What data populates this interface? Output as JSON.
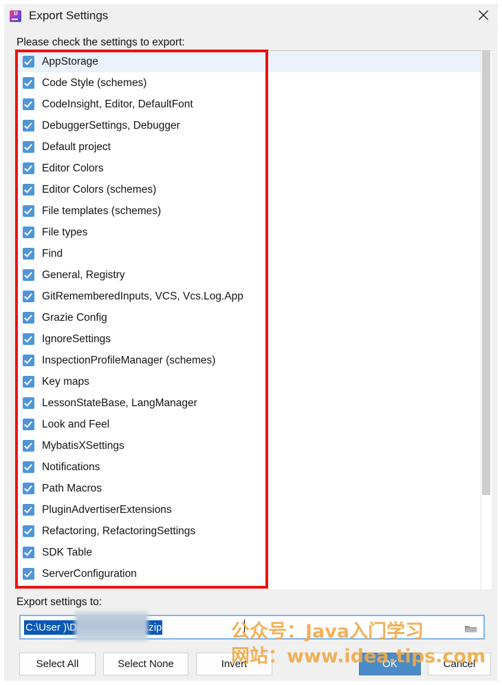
{
  "window": {
    "title": "Export Settings",
    "app_icon": "intellij-idea-icon",
    "close_icon": "close-icon"
  },
  "instruction": "Please check the settings to export:",
  "settings_list": {
    "items": [
      {
        "label": "AppStorage",
        "checked": true,
        "selected": true
      },
      {
        "label": "Code Style (schemes)",
        "checked": true,
        "selected": false
      },
      {
        "label": "CodeInsight, Editor, DefaultFont",
        "checked": true,
        "selected": false
      },
      {
        "label": "DebuggerSettings, Debugger",
        "checked": true,
        "selected": false
      },
      {
        "label": "Default project",
        "checked": true,
        "selected": false
      },
      {
        "label": "Editor Colors",
        "checked": true,
        "selected": false
      },
      {
        "label": "Editor Colors (schemes)",
        "checked": true,
        "selected": false
      },
      {
        "label": "File templates (schemes)",
        "checked": true,
        "selected": false
      },
      {
        "label": "File types",
        "checked": true,
        "selected": false
      },
      {
        "label": "Find",
        "checked": true,
        "selected": false
      },
      {
        "label": "General, Registry",
        "checked": true,
        "selected": false
      },
      {
        "label": "GitRememberedInputs, VCS, Vcs.Log.App",
        "checked": true,
        "selected": false
      },
      {
        "label": "Grazie Config",
        "checked": true,
        "selected": false
      },
      {
        "label": "IgnoreSettings",
        "checked": true,
        "selected": false
      },
      {
        "label": "InspectionProfileManager (schemes)",
        "checked": true,
        "selected": false
      },
      {
        "label": "Key maps",
        "checked": true,
        "selected": false
      },
      {
        "label": "LessonStateBase, LangManager",
        "checked": true,
        "selected": false
      },
      {
        "label": "Look and Feel",
        "checked": true,
        "selected": false
      },
      {
        "label": "MybatisXSettings",
        "checked": true,
        "selected": false
      },
      {
        "label": "Notifications",
        "checked": true,
        "selected": false
      },
      {
        "label": "Path Macros",
        "checked": true,
        "selected": false
      },
      {
        "label": "PluginAdvertiserExtensions",
        "checked": true,
        "selected": false
      },
      {
        "label": "Refactoring, RefactoringSettings",
        "checked": true,
        "selected": false
      },
      {
        "label": "SDK Table",
        "checked": true,
        "selected": false
      },
      {
        "label": "ServerConfiguration",
        "checked": true,
        "selected": false
      }
    ]
  },
  "export_to": {
    "label": "Export settings to:",
    "path_value": "C:\\User                    )\\Desktop\\settings.zip",
    "path_prefix": "C:\\User",
    "path_suffix": ")\\Desktop\\settings.zip",
    "browse_icon": "folder-icon"
  },
  "buttons": {
    "select_all": "Select All",
    "select_none": "Select None",
    "invert": "Invert",
    "ok": "OK",
    "cancel": "Cancel"
  },
  "watermark": {
    "line1": "公众号：Java入门学习",
    "line2": "网站：www.idea.tips.com",
    "color": "#f0ab4b"
  },
  "annotation": {
    "color": "#ee1111",
    "shape": "rectangle"
  },
  "colors": {
    "checkbox_blue": "#4f95d8",
    "selection_blue": "#eaf3fb",
    "ok_button_blue": "#4b8bc8",
    "path_selection_blue": "#0a58b5",
    "dialog_background": "#f0f0f0"
  }
}
